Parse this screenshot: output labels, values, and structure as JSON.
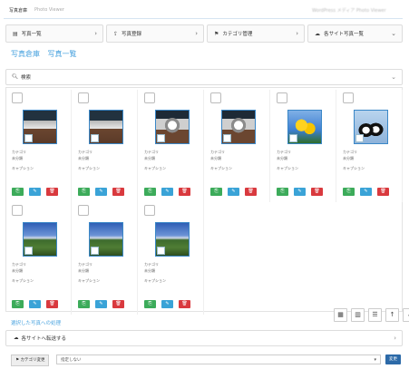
{
  "topbar": {
    "title": "写真倉庫",
    "subtitle": "Photo Viewer",
    "right": "WordPress メディア Photo Viewer"
  },
  "nav": [
    {
      "icon": "▤",
      "label": "写真一覧"
    },
    {
      "icon": "⇪",
      "label": "写真登録"
    },
    {
      "icon": "⚑",
      "label": "カテゴリ管理"
    },
    {
      "icon": "☁",
      "label": "各サイト写真一覧"
    }
  ],
  "breadcrumb": [
    "写真倉庫",
    "写真一覧"
  ],
  "search": {
    "label": "検索"
  },
  "photos": [
    {
      "style": "ph-tea",
      "cat_label": "カテゴリ",
      "cat_value": "未分類",
      "caption": "キャプション"
    },
    {
      "style": "ph-tea",
      "cat_label": "カテゴリ",
      "cat_value": "未分類",
      "caption": "キャプション"
    },
    {
      "style": "ph-tea2",
      "cat_label": "カテゴリ",
      "cat_value": "未分類",
      "caption": "キャプション"
    },
    {
      "style": "ph-tea2",
      "cat_label": "カテゴリ",
      "cat_value": "未分類",
      "caption": "キャプション"
    },
    {
      "style": "ph-flower",
      "cat_label": "カテゴリ",
      "cat_value": "未分類",
      "caption": "キャプション"
    },
    {
      "style": "ph-peng",
      "cat_label": "カテゴリ",
      "cat_value": "未分類",
      "caption": "キャプション"
    },
    {
      "style": "ph-land",
      "cat_label": "カテゴリ",
      "cat_value": "未分類",
      "caption": "キャプション"
    },
    {
      "style": "ph-land",
      "cat_label": "カテゴリ",
      "cat_value": "未分類",
      "caption": "キャプション"
    },
    {
      "style": "ph-land",
      "cat_label": "カテゴリ",
      "cat_value": "未分類",
      "caption": "キャプション"
    }
  ],
  "card_buttons": {
    "view": "⎘",
    "edit": "✎",
    "delete": "🗑"
  },
  "selected_action": "選択した写真への処理",
  "view_buttons": [
    "▦",
    "▥",
    "☰",
    "↑",
    "↓"
  ],
  "transfer": {
    "icon": "☁",
    "label": "各サイトへ転送する"
  },
  "category_bar": {
    "label": "カテゴリ変更",
    "select_value": "指定しない",
    "button": "変更"
  },
  "colors": {
    "link": "#4aa3df",
    "green": "#3cab5a",
    "blue": "#3aa3d7",
    "red": "#d9393e",
    "primary": "#2c6aa8"
  }
}
